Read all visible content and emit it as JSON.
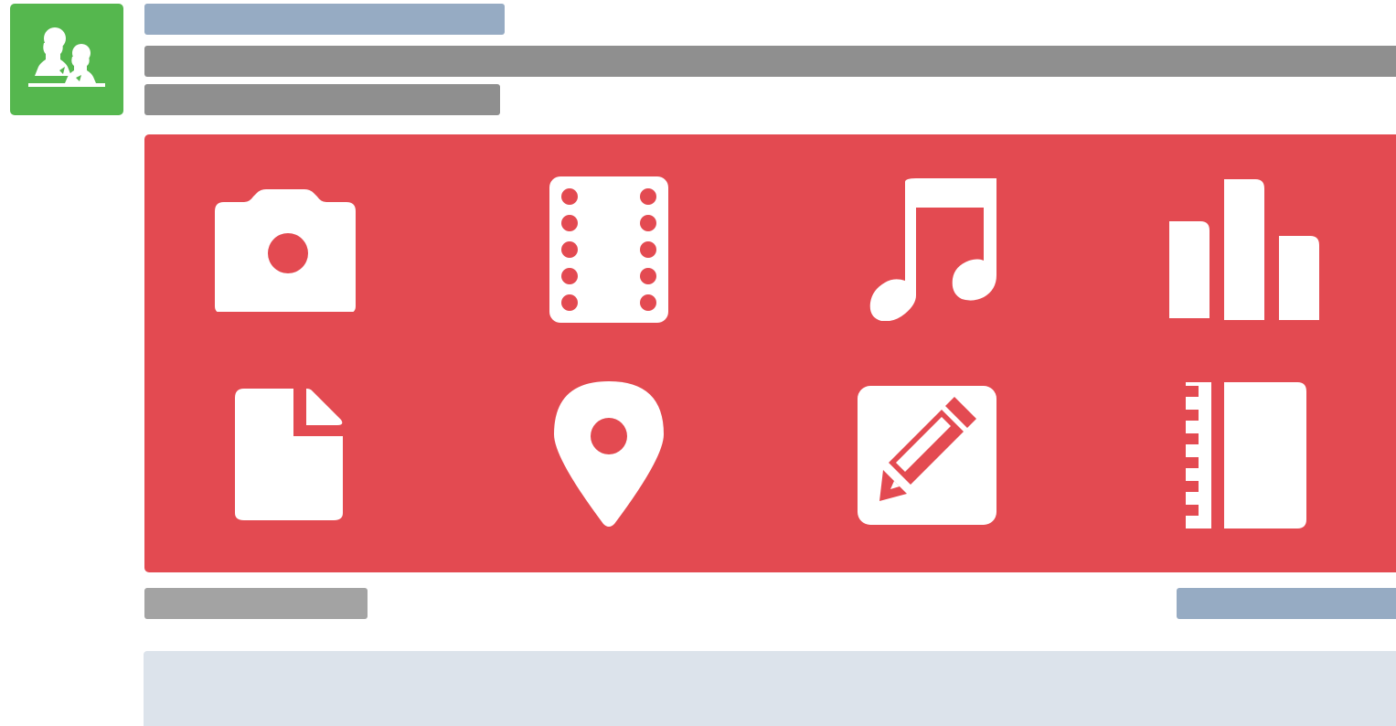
{
  "colors": {
    "avatar_bg": "#55b74e",
    "panel_bg": "#e34a51",
    "placeholder_blue": "#96abc3",
    "placeholder_gray": "#8f8f8f",
    "placeholder_light_gray": "#a3a3a3",
    "content_box": "#dce3eb",
    "icon_fill": "#ffffff"
  },
  "avatar": {
    "icon": "users-group-icon"
  },
  "media_panel": {
    "tiles": [
      {
        "icon": "camera-icon"
      },
      {
        "icon": "film-strip-icon"
      },
      {
        "icon": "music-note-icon"
      },
      {
        "icon": "bar-chart-icon"
      },
      {
        "icon": "document-icon"
      },
      {
        "icon": "map-pin-icon"
      },
      {
        "icon": "edit-pencil-icon"
      },
      {
        "icon": "notebook-ruler-icon"
      }
    ]
  }
}
